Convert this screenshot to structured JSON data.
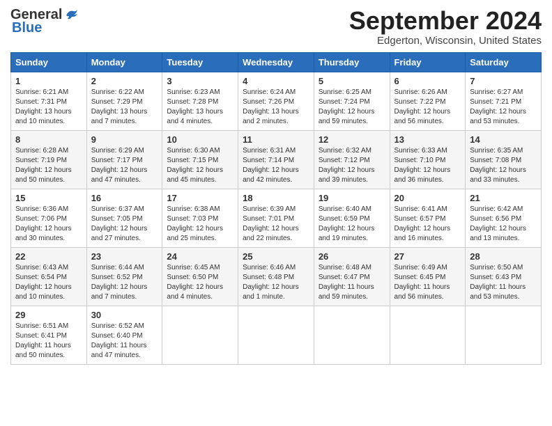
{
  "header": {
    "logo_general": "General",
    "logo_blue": "Blue",
    "month_title": "September 2024",
    "location": "Edgerton, Wisconsin, United States"
  },
  "weekdays": [
    "Sunday",
    "Monday",
    "Tuesday",
    "Wednesday",
    "Thursday",
    "Friday",
    "Saturday"
  ],
  "weeks": [
    [
      {
        "day": "1",
        "sunrise": "Sunrise: 6:21 AM",
        "sunset": "Sunset: 7:31 PM",
        "daylight": "Daylight: 13 hours and 10 minutes."
      },
      {
        "day": "2",
        "sunrise": "Sunrise: 6:22 AM",
        "sunset": "Sunset: 7:29 PM",
        "daylight": "Daylight: 13 hours and 7 minutes."
      },
      {
        "day": "3",
        "sunrise": "Sunrise: 6:23 AM",
        "sunset": "Sunset: 7:28 PM",
        "daylight": "Daylight: 13 hours and 4 minutes."
      },
      {
        "day": "4",
        "sunrise": "Sunrise: 6:24 AM",
        "sunset": "Sunset: 7:26 PM",
        "daylight": "Daylight: 13 hours and 2 minutes."
      },
      {
        "day": "5",
        "sunrise": "Sunrise: 6:25 AM",
        "sunset": "Sunset: 7:24 PM",
        "daylight": "Daylight: 12 hours and 59 minutes."
      },
      {
        "day": "6",
        "sunrise": "Sunrise: 6:26 AM",
        "sunset": "Sunset: 7:22 PM",
        "daylight": "Daylight: 12 hours and 56 minutes."
      },
      {
        "day": "7",
        "sunrise": "Sunrise: 6:27 AM",
        "sunset": "Sunset: 7:21 PM",
        "daylight": "Daylight: 12 hours and 53 minutes."
      }
    ],
    [
      {
        "day": "8",
        "sunrise": "Sunrise: 6:28 AM",
        "sunset": "Sunset: 7:19 PM",
        "daylight": "Daylight: 12 hours and 50 minutes."
      },
      {
        "day": "9",
        "sunrise": "Sunrise: 6:29 AM",
        "sunset": "Sunset: 7:17 PM",
        "daylight": "Daylight: 12 hours and 47 minutes."
      },
      {
        "day": "10",
        "sunrise": "Sunrise: 6:30 AM",
        "sunset": "Sunset: 7:15 PM",
        "daylight": "Daylight: 12 hours and 45 minutes."
      },
      {
        "day": "11",
        "sunrise": "Sunrise: 6:31 AM",
        "sunset": "Sunset: 7:14 PM",
        "daylight": "Daylight: 12 hours and 42 minutes."
      },
      {
        "day": "12",
        "sunrise": "Sunrise: 6:32 AM",
        "sunset": "Sunset: 7:12 PM",
        "daylight": "Daylight: 12 hours and 39 minutes."
      },
      {
        "day": "13",
        "sunrise": "Sunrise: 6:33 AM",
        "sunset": "Sunset: 7:10 PM",
        "daylight": "Daylight: 12 hours and 36 minutes."
      },
      {
        "day": "14",
        "sunrise": "Sunrise: 6:35 AM",
        "sunset": "Sunset: 7:08 PM",
        "daylight": "Daylight: 12 hours and 33 minutes."
      }
    ],
    [
      {
        "day": "15",
        "sunrise": "Sunrise: 6:36 AM",
        "sunset": "Sunset: 7:06 PM",
        "daylight": "Daylight: 12 hours and 30 minutes."
      },
      {
        "day": "16",
        "sunrise": "Sunrise: 6:37 AM",
        "sunset": "Sunset: 7:05 PM",
        "daylight": "Daylight: 12 hours and 27 minutes."
      },
      {
        "day": "17",
        "sunrise": "Sunrise: 6:38 AM",
        "sunset": "Sunset: 7:03 PM",
        "daylight": "Daylight: 12 hours and 25 minutes."
      },
      {
        "day": "18",
        "sunrise": "Sunrise: 6:39 AM",
        "sunset": "Sunset: 7:01 PM",
        "daylight": "Daylight: 12 hours and 22 minutes."
      },
      {
        "day": "19",
        "sunrise": "Sunrise: 6:40 AM",
        "sunset": "Sunset: 6:59 PM",
        "daylight": "Daylight: 12 hours and 19 minutes."
      },
      {
        "day": "20",
        "sunrise": "Sunrise: 6:41 AM",
        "sunset": "Sunset: 6:57 PM",
        "daylight": "Daylight: 12 hours and 16 minutes."
      },
      {
        "day": "21",
        "sunrise": "Sunrise: 6:42 AM",
        "sunset": "Sunset: 6:56 PM",
        "daylight": "Daylight: 12 hours and 13 minutes."
      }
    ],
    [
      {
        "day": "22",
        "sunrise": "Sunrise: 6:43 AM",
        "sunset": "Sunset: 6:54 PM",
        "daylight": "Daylight: 12 hours and 10 minutes."
      },
      {
        "day": "23",
        "sunrise": "Sunrise: 6:44 AM",
        "sunset": "Sunset: 6:52 PM",
        "daylight": "Daylight: 12 hours and 7 minutes."
      },
      {
        "day": "24",
        "sunrise": "Sunrise: 6:45 AM",
        "sunset": "Sunset: 6:50 PM",
        "daylight": "Daylight: 12 hours and 4 minutes."
      },
      {
        "day": "25",
        "sunrise": "Sunrise: 6:46 AM",
        "sunset": "Sunset: 6:48 PM",
        "daylight": "Daylight: 12 hours and 1 minute."
      },
      {
        "day": "26",
        "sunrise": "Sunrise: 6:48 AM",
        "sunset": "Sunset: 6:47 PM",
        "daylight": "Daylight: 11 hours and 59 minutes."
      },
      {
        "day": "27",
        "sunrise": "Sunrise: 6:49 AM",
        "sunset": "Sunset: 6:45 PM",
        "daylight": "Daylight: 11 hours and 56 minutes."
      },
      {
        "day": "28",
        "sunrise": "Sunrise: 6:50 AM",
        "sunset": "Sunset: 6:43 PM",
        "daylight": "Daylight: 11 hours and 53 minutes."
      }
    ],
    [
      {
        "day": "29",
        "sunrise": "Sunrise: 6:51 AM",
        "sunset": "Sunset: 6:41 PM",
        "daylight": "Daylight: 11 hours and 50 minutes."
      },
      {
        "day": "30",
        "sunrise": "Sunrise: 6:52 AM",
        "sunset": "Sunset: 6:40 PM",
        "daylight": "Daylight: 11 hours and 47 minutes."
      },
      null,
      null,
      null,
      null,
      null
    ]
  ]
}
